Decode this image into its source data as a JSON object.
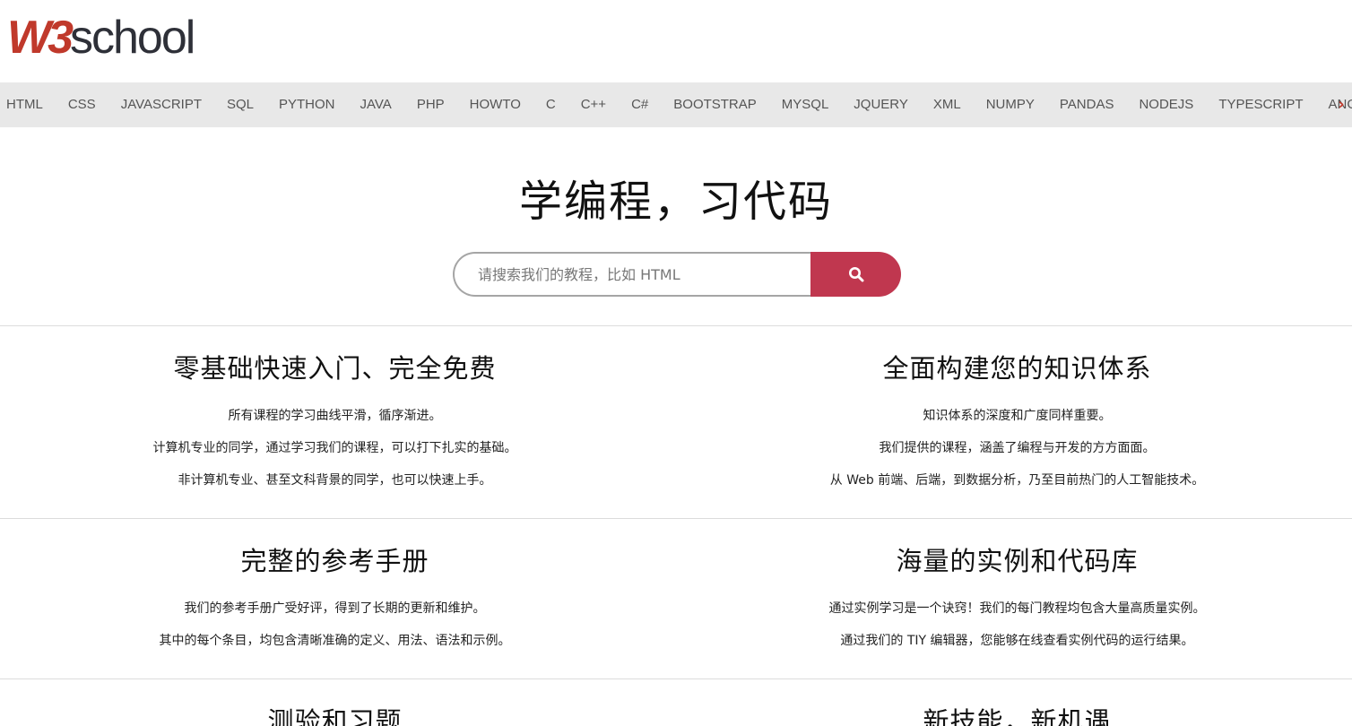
{
  "logo": {
    "w3": "W3",
    "school": "school"
  },
  "nav": {
    "items": [
      "HTML",
      "CSS",
      "JAVASCRIPT",
      "SQL",
      "PYTHON",
      "JAVA",
      "PHP",
      "HOWTO",
      "C",
      "C++",
      "C#",
      "BOOTSTRAP",
      "MYSQL",
      "JQUERY",
      "XML",
      "NUMPY",
      "PANDAS",
      "NODEJS",
      "TYPESCRIPT",
      "ANGULARJS"
    ],
    "more_glyph": "›"
  },
  "hero": {
    "title": "学编程，习代码",
    "search_placeholder": "请搜索我们的教程，比如 HTML",
    "search_value": ""
  },
  "features": [
    {
      "title": "零基础快速入门、完全免费",
      "lines": [
        "所有课程的学习曲线平滑，循序渐进。",
        "计算机专业的同学，通过学习我们的课程，可以打下扎实的基础。",
        "非计算机专业、甚至文科背景的同学，也可以快速上手。"
      ]
    },
    {
      "title": "全面构建您的知识体系",
      "lines": [
        "知识体系的深度和广度同样重要。",
        "我们提供的课程，涵盖了编程与开发的方方面面。",
        "从 Web 前端、后端，到数据分析，乃至目前热门的人工智能技术。"
      ]
    },
    {
      "title": "完整的参考手册",
      "lines": [
        "我们的参考手册广受好评，得到了长期的更新和维护。",
        "其中的每个条目，均包含清晰准确的定义、用法、语法和示例。"
      ]
    },
    {
      "title": "海量的实例和代码库",
      "lines": [
        "通过实例学习是一个诀窍！我们的每门教程均包含大量高质量实例。",
        "通过我们的 TIY 编辑器，您能够在线查看实例代码的运行结果。"
      ]
    },
    {
      "title": "测验和习题",
      "lines": []
    },
    {
      "title": "新技能，新机遇",
      "lines": []
    }
  ],
  "colors": {
    "brand_red": "#c0374f",
    "logo_dark": "#2e3038",
    "nav_bg": "#e8e8e8"
  },
  "icons": {
    "search": "search-icon",
    "more": "chevron-right-icon"
  }
}
